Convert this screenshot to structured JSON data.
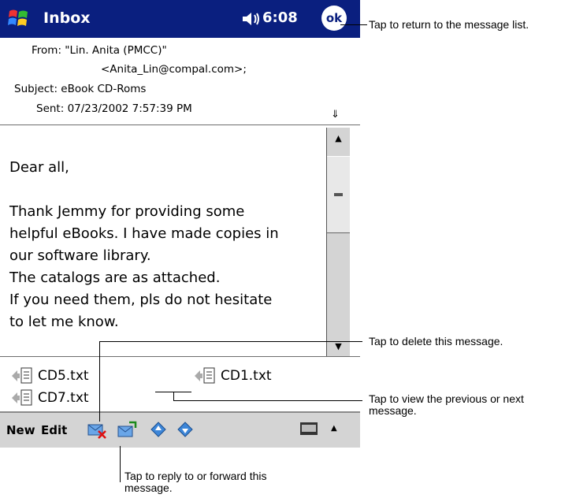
{
  "titlebar": {
    "start_icon": "windows-flag-icon",
    "title": "Inbox",
    "speaker_icon": "speaker-icon",
    "clock": "6:08",
    "ok_label": "ok"
  },
  "header": {
    "from_line1": "From: \"Lin. Anita (PMCC)\"",
    "from_line2": "<Anita_Lin@compal.com>;",
    "subject": "Subject: eBook CD-Roms",
    "sent": "Sent: 07/23/2002 7:57:39 PM",
    "expand_icon": "double-chevron-down-icon"
  },
  "body": {
    "lines": [
      "Dear all,",
      "Thank Jemmy for providing some",
      "helpful eBooks. I have made copies in",
      "our software library.",
      "The catalogs are as attached.",
      "If  you need them, pls do not hesitate",
      "to let me know."
    ]
  },
  "attachments": [
    {
      "name": "CD5.txt"
    },
    {
      "name": "CD1.txt"
    },
    {
      "name": "CD7.txt"
    }
  ],
  "toolbar": {
    "menu_new": "New",
    "menu_edit": "Edit",
    "delete_icon": "delete-message-icon",
    "reply_icon": "reply-forward-icon",
    "prev_icon": "previous-message-icon",
    "next_icon": "next-message-icon",
    "keyboard_icon": "keyboard-icon"
  },
  "callouts": {
    "return": "Tap to return to the message list.",
    "delete": "Tap to delete this message.",
    "prevnext_line1": "Tap to view the previous or next",
    "prevnext_line2": "message.",
    "reply_line1": "Tap to reply to or forward this",
    "reply_line2": "message."
  },
  "colors": {
    "titlebar": "#0a1f7f",
    "toolbar": "#d4d4d4"
  }
}
